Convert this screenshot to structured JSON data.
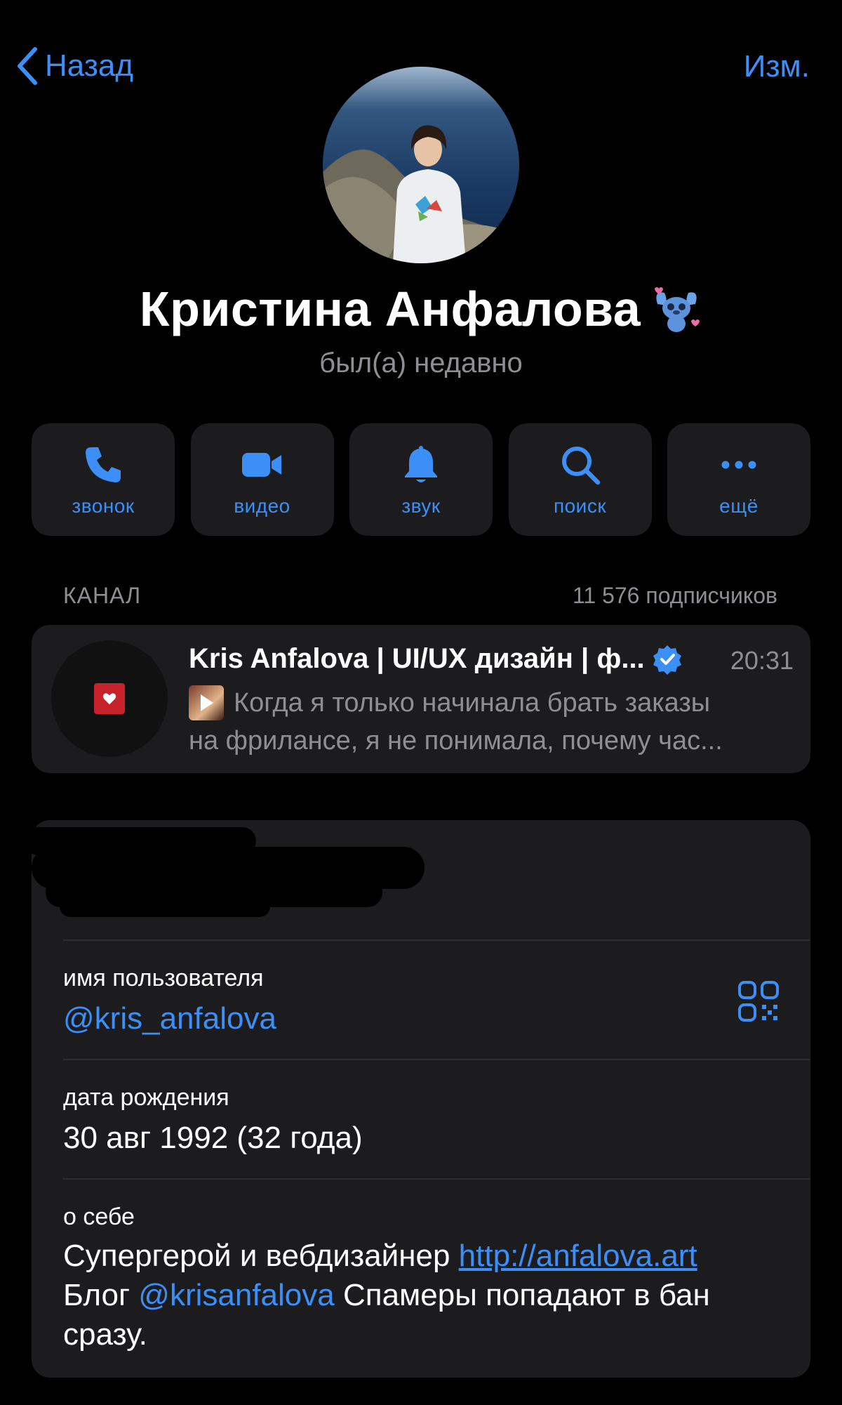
{
  "nav": {
    "back_label": "Назад",
    "edit_label": "Изм."
  },
  "profile": {
    "name": "Кристина Анфалова",
    "status": "был(а) недавно"
  },
  "actions": [
    {
      "label": "звонок",
      "icon": "phone-icon"
    },
    {
      "label": "видео",
      "icon": "video-icon"
    },
    {
      "label": "звук",
      "icon": "bell-icon"
    },
    {
      "label": "поиск",
      "icon": "search-icon"
    },
    {
      "label": "ещё",
      "icon": "more-icon"
    }
  ],
  "channel": {
    "section_label": "КАНАЛ",
    "subscribers": "11 576 подписчиков",
    "title": "Kris Anfalova | UI/UX дизайн | ф...",
    "time": "20:31",
    "message_line1": "Когда я только начинала брать заказы",
    "message_line2": "на фрилансе, я не понимала, почему час..."
  },
  "info": {
    "username_label": "имя пользователя",
    "username": "@kris_anfalova",
    "birthday_label": "дата рождения",
    "birthday": "30 авг 1992 (32 года)",
    "about_label": "о себе",
    "about_text1": "Супергерой и вебдизайнер ",
    "about_link": "http://anfalova.art",
    "about_text2": "Блог ",
    "about_mention": "@krisanfalova",
    "about_text3": " Спамеры попадают в бан сразу."
  },
  "colors": {
    "accent": "#3b8ff6",
    "card": "#1c1c1e",
    "secondary": "#8e8e93"
  }
}
